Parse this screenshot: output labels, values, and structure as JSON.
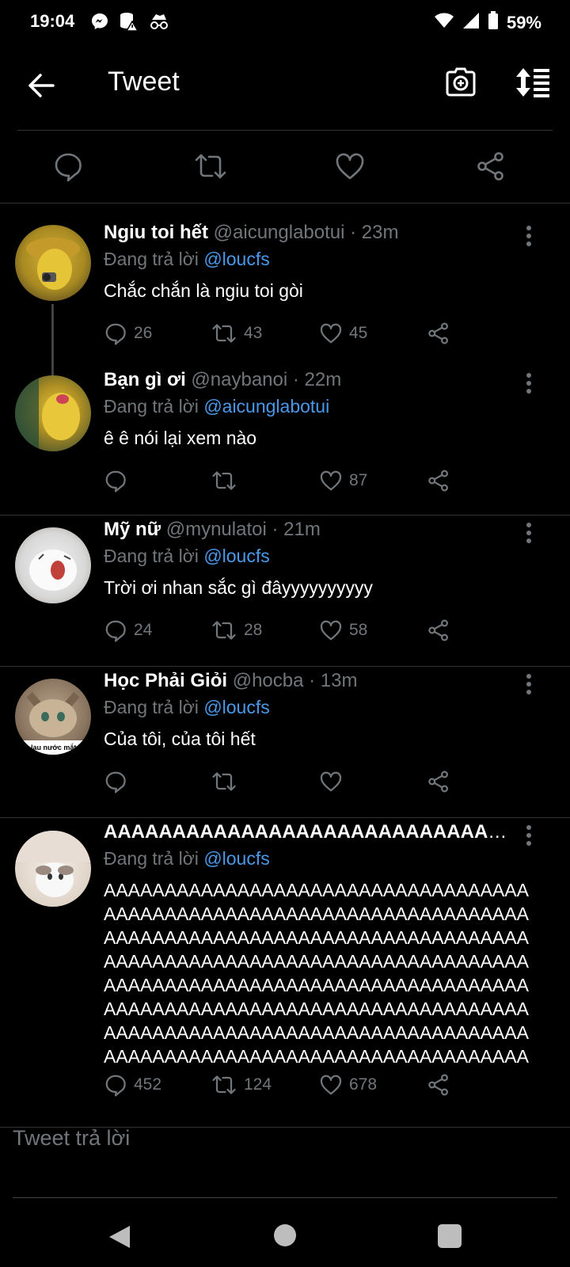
{
  "status_bar": {
    "time": "19:04",
    "battery": "59%",
    "icons": [
      "messenger-icon",
      "storage-alert-icon",
      "incognito-icon",
      "wifi-icon",
      "signal-icon",
      "battery-icon"
    ]
  },
  "header": {
    "title": "Tweet"
  },
  "colors": {
    "background": "#000000",
    "muted": "#71767b",
    "mention": "#4a99e9",
    "divider": "#2f3336"
  },
  "tweets": [
    {
      "name": "Ngiu toi hết",
      "handle": "@aicunglabotui · 23m",
      "reply_prefix": "Đang trả lời",
      "reply_to": "@loucfs",
      "text": "Chắc chắn là ngiu toi gòi",
      "replies": "26",
      "retweets": "43",
      "likes": "45"
    },
    {
      "name": "Bạn gì ơi",
      "handle": "@naybanoi · 22m",
      "reply_prefix": "Đang trả lời",
      "reply_to": "@aicunglabotui",
      "text": "ê ê nói lại xem nào",
      "replies": "",
      "retweets": "",
      "likes": "87"
    },
    {
      "name": "Mỹ nữ",
      "handle": "@mynulatoi · 21m",
      "reply_prefix": "Đang trả lời",
      "reply_to": "@loucfs",
      "text": "Trời ơi nhan sắc gì đâyyyyyyyyyy",
      "replies": "24",
      "retweets": "28",
      "likes": "58"
    },
    {
      "name": "Học Phải Giỏi",
      "handle": "@hocba · 13m",
      "reply_prefix": "Đang trả lời",
      "reply_to": "@loucfs",
      "text": "Của tôi, của tôi hết",
      "replies": "",
      "retweets": "",
      "likes": "",
      "avatar_caption": "lau nước mắt"
    },
    {
      "name": "AAAAAAAAAAAAAAAAAAAAAAAAAAAAAAA...",
      "handle": "",
      "reply_prefix": "Đang trả lời",
      "reply_to": "@loucfs",
      "text_lines": [
        "AAAAAAAAAAAAAAAAAAAAAAAAAAAAAAAAAAA",
        "AAAAAAAAAAAAAAAAAAAAAAAAAAAAAAAAAAA",
        "AAAAAAAAAAAAAAAAAAAAAAAAAAAAAAAAAAA",
        "AAAAAAAAAAAAAAAAAAAAAAAAAAAAAAAAAAA",
        "AAAAAAAAAAAAAAAAAAAAAAAAAAAAAAAAAAA",
        "AAAAAAAAAAAAAAAAAAAAAAAAAAAAAAAAAAA",
        "AAAAAAAAAAAAAAAAAAAAAAAAAAAAAAAAAAA",
        "AAAAAAAAAAAAAAAAAAAAAAAAAAAAAAAAAAA"
      ],
      "replies": "452",
      "retweets": "124",
      "likes": "678"
    }
  ],
  "reply_input": {
    "placeholder": "Tweet trả lời"
  }
}
